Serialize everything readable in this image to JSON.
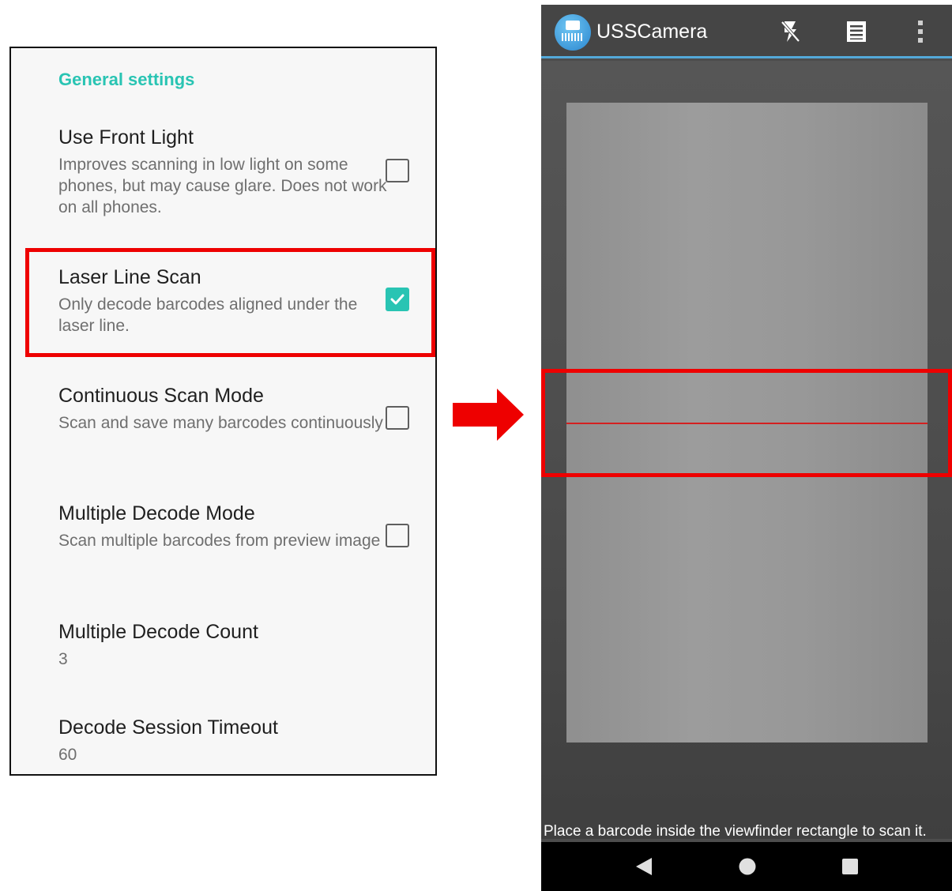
{
  "settings": {
    "section_header": "General settings",
    "items": [
      {
        "title": "Use Front Light",
        "summary": "Improves scanning in low light on some phones, but may cause glare. Does not work on all phones.",
        "checked": false
      },
      {
        "title": "Laser Line Scan",
        "summary": "Only decode barcodes aligned under the laser line.",
        "checked": true
      },
      {
        "title": "Continuous Scan Mode",
        "summary": "Scan and save many barcodes continuously",
        "checked": false
      },
      {
        "title": "Multiple Decode Mode",
        "summary": "Scan multiple barcodes from preview image",
        "checked": false
      },
      {
        "title": "Multiple Decode Count",
        "summary": "3"
      },
      {
        "title": "Decode Session Timeout",
        "summary": "60"
      }
    ]
  },
  "camera": {
    "app_title": "USSCamera",
    "status_text": "Place a barcode inside the viewfinder rectangle to scan it.",
    "icons": {
      "app": "usscamera-app-icon",
      "flash": "flash-off-icon",
      "history": "history-list-icon",
      "overflow": "more-vert-icon"
    }
  },
  "colors": {
    "accent": "#29c4b3",
    "highlight": "#ee0000",
    "laser": "#d42020",
    "appbar_divider": "#53a9d9"
  }
}
